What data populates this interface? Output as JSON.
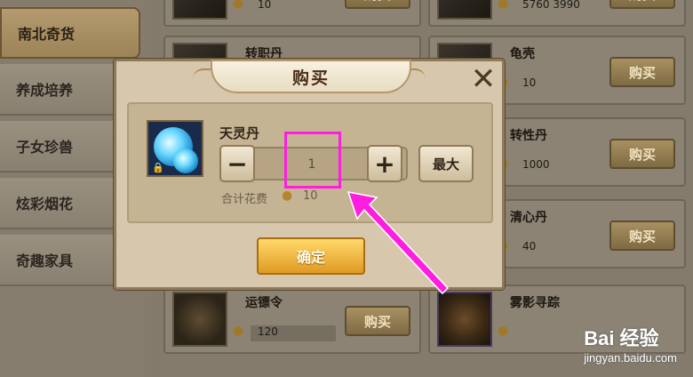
{
  "sidebar": {
    "items": [
      {
        "label": "南北奇货",
        "active": true
      },
      {
        "label": "养成培养",
        "active": false
      },
      {
        "label": "子女珍兽",
        "active": false
      },
      {
        "label": "炫彩烟花",
        "active": false
      },
      {
        "label": "奇趣家具",
        "active": false
      }
    ]
  },
  "shop": {
    "buy_label": "购买",
    "items": [
      {
        "name": "",
        "price": "10"
      },
      {
        "name": "",
        "price": "5760 3990"
      },
      {
        "name": "转职丹",
        "price": ""
      },
      {
        "name": "龟壳",
        "price": "10"
      },
      {
        "name": "",
        "price": ""
      },
      {
        "name": "转性丹",
        "price": "1000"
      },
      {
        "name": "",
        "price": ""
      },
      {
        "name": "清心丹",
        "price": "40"
      },
      {
        "name": "运镖令",
        "price": "120"
      },
      {
        "name": "雾影寻踪",
        "price": ""
      }
    ]
  },
  "dialog": {
    "title": "购买",
    "close_icon": "✕",
    "item_name": "天灵丹",
    "quantity": "1",
    "minus": "−",
    "plus": "+",
    "max_label": "最大",
    "total_label": "合计花费",
    "total_value": "10",
    "confirm_label": "确定"
  },
  "colors": {
    "highlight": "#ff1ee0",
    "confirm": "#f5b33a"
  },
  "watermark": {
    "logo": "Bai 经验",
    "url": "jingyan.baidu.com"
  }
}
